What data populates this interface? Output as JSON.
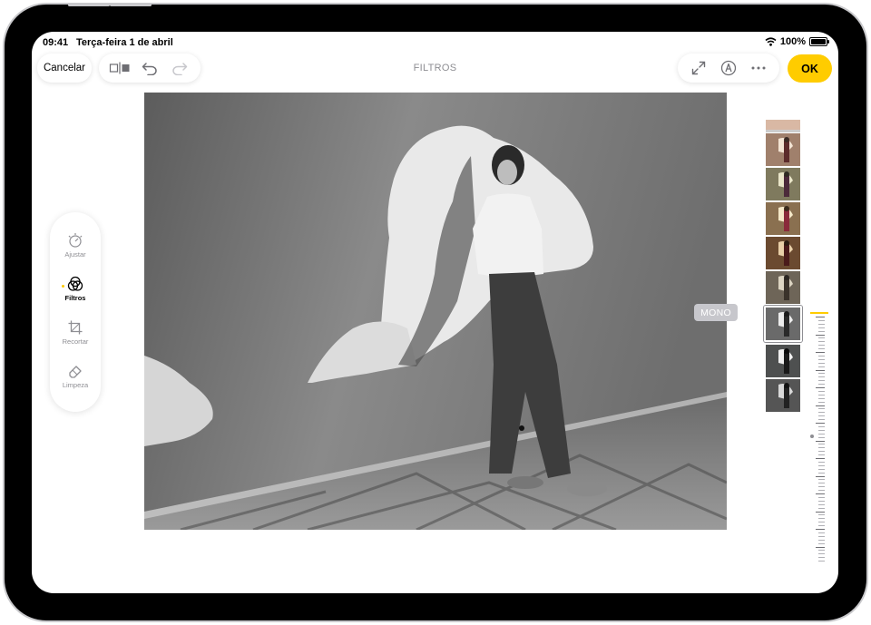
{
  "status_bar": {
    "time": "09:41",
    "date": "Terça-feira 1 de abril",
    "battery": "100%"
  },
  "toolbar": {
    "cancel_label": "Cancelar",
    "title": "FILTROS",
    "ok_label": "OK"
  },
  "side_tools": [
    {
      "label": "Ajustar",
      "icon": "adjust-dial-icon"
    },
    {
      "label": "Filtros",
      "icon": "filters-circles-icon",
      "active": true
    },
    {
      "label": "Recortar",
      "icon": "crop-icon"
    },
    {
      "label": "Limpeza",
      "icon": "eraser-icon"
    }
  ],
  "filter": {
    "selected_name": "MONO"
  },
  "colors": {
    "accent": "#ffcc00",
    "bezel": "#000000",
    "secondary_text": "#8e8e93",
    "mono_badge": "#c7c7cc"
  }
}
